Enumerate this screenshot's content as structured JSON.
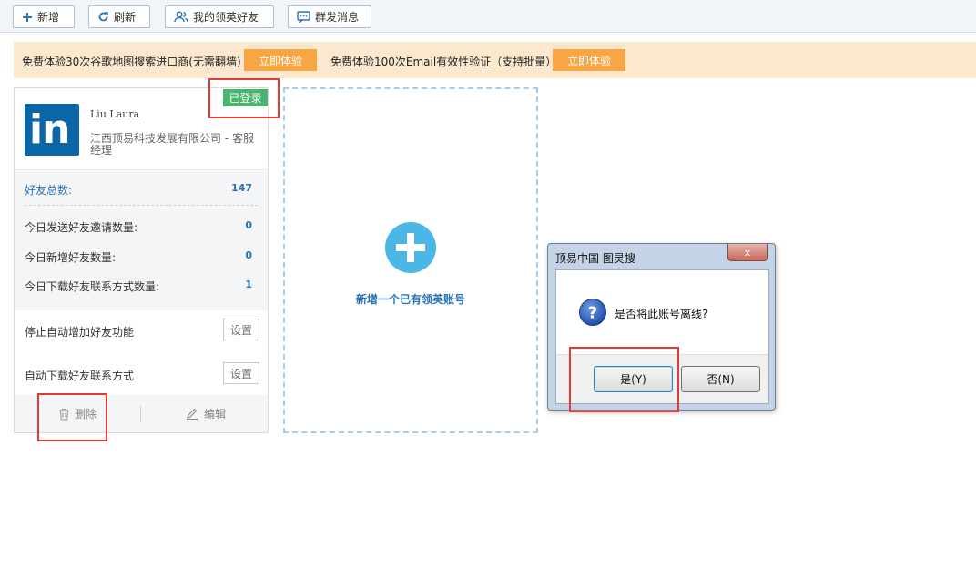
{
  "toolbar": {
    "add_label": "新增",
    "refresh_label": "刷新",
    "friends_label": "我的领英好友",
    "broadcast_label": "群发消息"
  },
  "promo": {
    "text1": "免费体验30次谷歌地图搜索进口商(无需翻墙)",
    "btn1": "立即体验",
    "text2": "免费体验100次Email有效性验证（支持批量）",
    "btn2": "立即体验"
  },
  "account": {
    "logo_text": "in",
    "name": "Liu Laura",
    "company": "江西顶易科技发展有限公司 - 客服经理",
    "status": "已登录",
    "stats": [
      {
        "label": "好友总数:",
        "value": "147"
      },
      {
        "label": "今日发送好友邀请数量:",
        "value": "0"
      },
      {
        "label": "今日新增好友数量:",
        "value": "0"
      },
      {
        "label": "今日下载好友联系方式数量:",
        "value": "1"
      }
    ],
    "settings": [
      {
        "label": "停止自动增加好友功能",
        "button": "设置"
      },
      {
        "label": "自动下载好友联系方式",
        "button": "设置"
      }
    ],
    "delete_label": "删除",
    "edit_label": "编辑"
  },
  "add_account": {
    "label": "新增一个已有领英账号"
  },
  "dialog": {
    "title": "顶易中国 图灵搜",
    "message": "是否将此账号离线?",
    "yes_label": "是(Y)",
    "no_label": "否(N)",
    "close_glyph": "x"
  },
  "colors": {
    "accent": "#2b74b8",
    "promo_bg": "#fbe8cf",
    "promo_button": "#f8a544",
    "login_badge": "#4bb46f",
    "linkedin": "#0b66a8",
    "highlight": "#e53935"
  }
}
